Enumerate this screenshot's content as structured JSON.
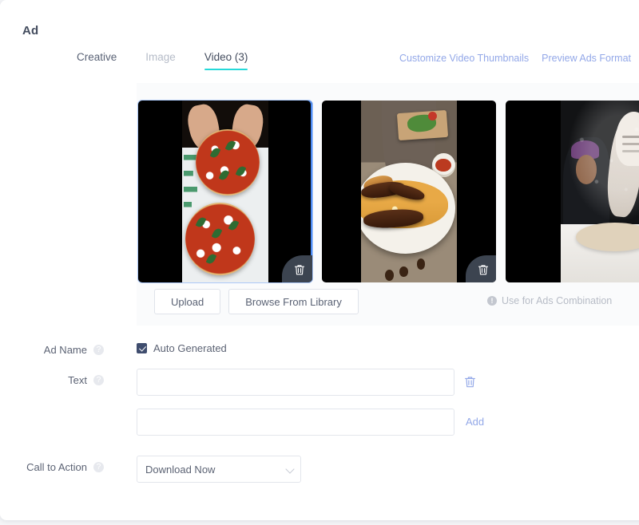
{
  "section": {
    "title": "Ad"
  },
  "tabs": [
    {
      "label": "Creative",
      "state": "normal"
    },
    {
      "label": "Image",
      "state": "muted"
    },
    {
      "label": "Video (3)",
      "state": "active"
    }
  ],
  "header_links": [
    {
      "label": "Customize Video Thumbnails"
    },
    {
      "label": "Preview Ads Format"
    }
  ],
  "media": {
    "thumbnails": [
      {
        "alt": "Two margherita pizzas being cut by hands",
        "selected": true,
        "delete_icon": "trash-icon"
      },
      {
        "alt": "Biryani rice plate with roasted meat",
        "selected": false,
        "delete_icon": "trash-icon"
      },
      {
        "alt": "Floured hands tossing dough on dark background",
        "selected": false,
        "delete_icon": "trash-icon"
      }
    ],
    "upload_label": "Upload",
    "browse_label": "Browse From Library",
    "combination_label": "Use for Ads Combination",
    "combination_icon": "info-icon"
  },
  "form": {
    "ad_name": {
      "label": "Ad Name",
      "help_icon": "help-icon",
      "checkbox_label": "Auto Generated",
      "checked": true
    },
    "text": {
      "label": "Text",
      "help_icon": "help-icon",
      "value_1": "",
      "placeholder_1": "",
      "value_2": "",
      "placeholder_2": "",
      "delete_icon": "trash-icon",
      "add_label": "Add"
    },
    "call_to_action": {
      "label": "Call to Action",
      "help_icon": "help-icon",
      "selected": "Download Now",
      "chevron_icon": "chevron-down-icon"
    }
  },
  "colors": {
    "accent_tab": "#25d9d9",
    "link": "#93a8e8",
    "checkbox": "#3f4d6e",
    "selected_border": "#4d8cf5",
    "text": "#5c6374"
  }
}
